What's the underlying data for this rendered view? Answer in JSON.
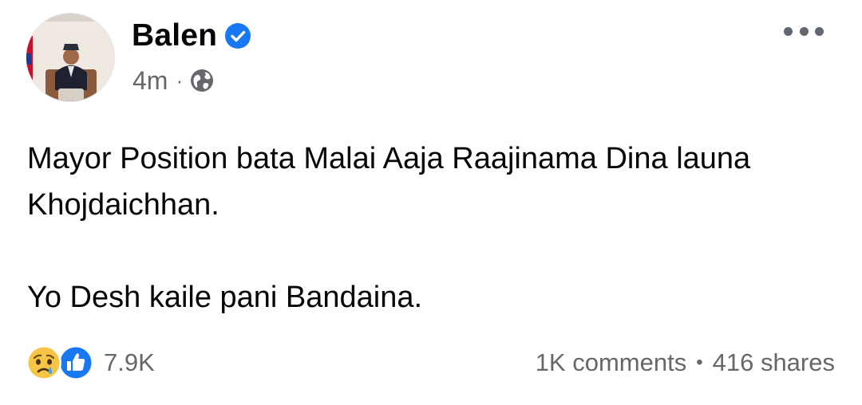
{
  "post": {
    "author": "Balen",
    "time": "4m",
    "meta_separator": "·",
    "paragraphs": [
      "Mayor Position bata Malai Aaja Raajinama Dina launa Khojdaichhan.",
      "Yo Desh kaile pani Bandaina."
    ]
  },
  "footer": {
    "reaction_count": "7.9K",
    "comments": "1K comments",
    "separator": "•",
    "shares": "416 shares"
  },
  "icons": {
    "verified": "verified-badge-icon",
    "audience": "globe-icon",
    "menu": "more-options-icon",
    "reaction_1": "sad-reaction-icon",
    "reaction_2": "like-reaction-icon"
  },
  "colors": {
    "verified_blue": "#1877f2",
    "secondary_text": "#65676b",
    "primary_text": "#050505",
    "sad_yellow": "#f7c545"
  }
}
